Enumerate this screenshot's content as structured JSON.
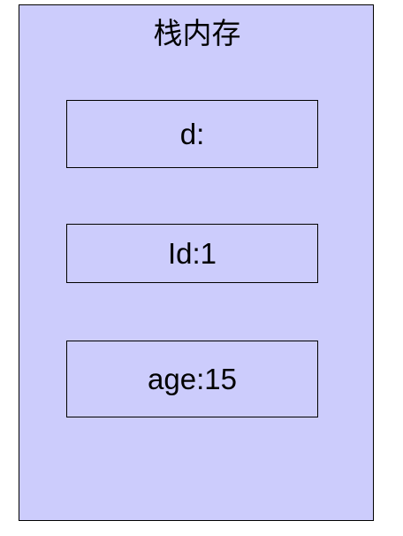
{
  "diagram": {
    "title": "栈内存",
    "variables": [
      {
        "label": "d:"
      },
      {
        "label": "Id:1"
      },
      {
        "label": "age:15"
      }
    ],
    "colors": {
      "fill": "#ccccfc",
      "stroke": "#000000"
    }
  }
}
